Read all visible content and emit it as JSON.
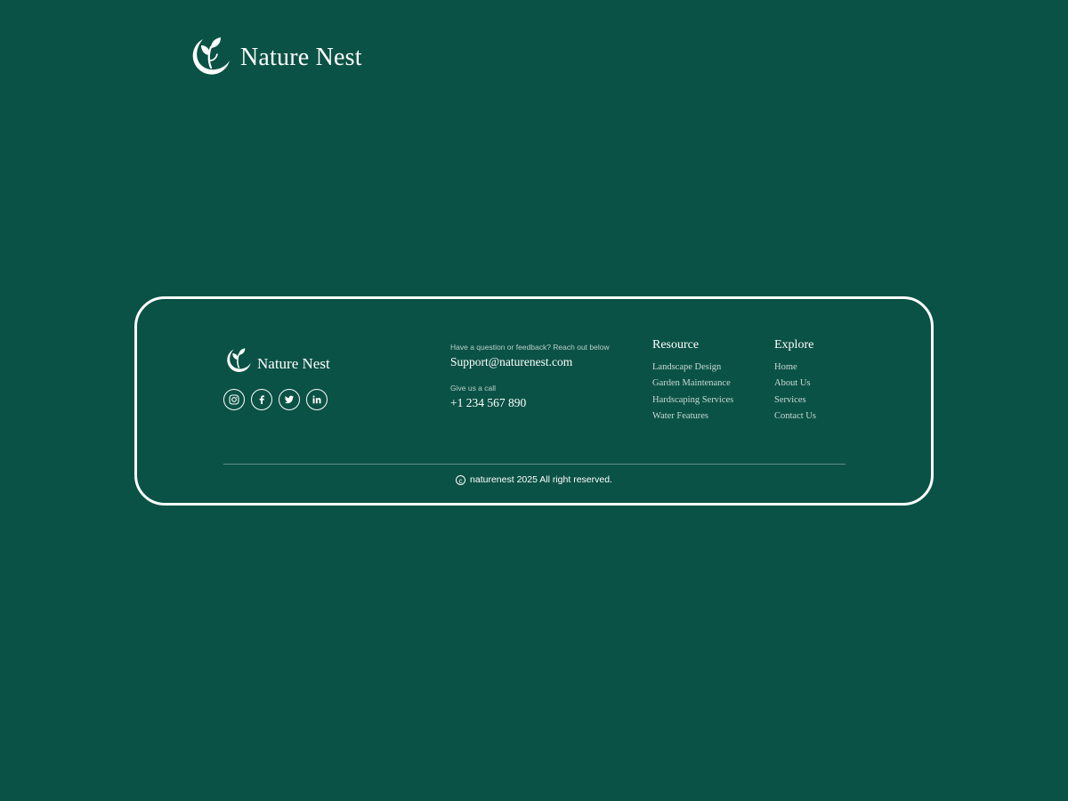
{
  "header": {
    "brand_name": "Nature Nest",
    "logo_icon": "leaf-sprout-logo-icon"
  },
  "footer": {
    "brand_name": "Nature Nest",
    "social": [
      {
        "name": "instagram",
        "icon": "instagram-icon"
      },
      {
        "name": "facebook",
        "icon": "facebook-icon"
      },
      {
        "name": "twitter",
        "icon": "twitter-icon"
      },
      {
        "name": "linkedin",
        "icon": "linkedin-icon"
      }
    ],
    "contact": {
      "email_label": "Have a question or feedback? Reach out below",
      "email": "Support@naturenest.com",
      "phone_label": "Give us a call",
      "phone": "+1 234 567 890"
    },
    "resource": {
      "title": "Resource",
      "links": [
        "Landscape Design",
        "Garden Maintenance",
        "Hardscaping Services",
        "Water Features"
      ]
    },
    "explore": {
      "title": "Explore",
      "links": [
        "Home",
        "About Us",
        "Services",
        "Contact Us"
      ]
    },
    "copyright": {
      "symbol": "c",
      "text": "naturenest 2025 All right reserved."
    }
  },
  "colors": {
    "background": "#0b5246",
    "foreground": "#ffffff",
    "muted_text": "#c7d9d4",
    "divider": "#5e8d84"
  }
}
